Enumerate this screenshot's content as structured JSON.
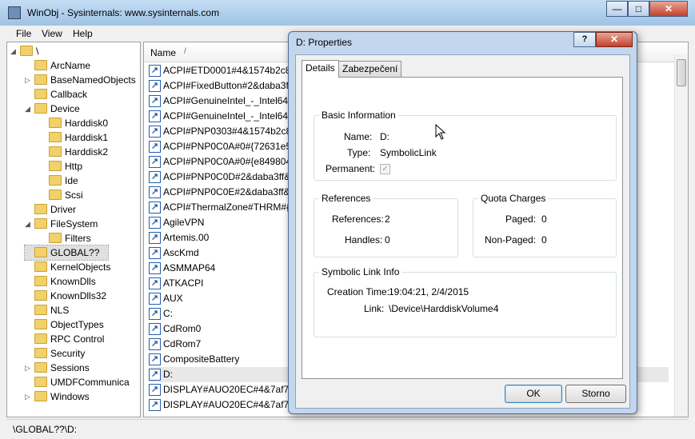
{
  "window": {
    "title": "WinObj - Sysinternals: www.sysinternals.com",
    "min": "—",
    "max": "□",
    "close": "✕"
  },
  "menu": [
    "File",
    "View",
    "Help"
  ],
  "tree": [
    {
      "label": "\\",
      "depth": 0,
      "expander": "◢"
    },
    {
      "label": "ArcName",
      "depth": 1,
      "expander": ""
    },
    {
      "label": "BaseNamedObjects",
      "depth": 1,
      "expander": "▷"
    },
    {
      "label": "Callback",
      "depth": 1,
      "expander": ""
    },
    {
      "label": "Device",
      "depth": 1,
      "expander": "◢"
    },
    {
      "label": "Harddisk0",
      "depth": 2,
      "expander": ""
    },
    {
      "label": "Harddisk1",
      "depth": 2,
      "expander": ""
    },
    {
      "label": "Harddisk2",
      "depth": 2,
      "expander": ""
    },
    {
      "label": "Http",
      "depth": 2,
      "expander": ""
    },
    {
      "label": "Ide",
      "depth": 2,
      "expander": ""
    },
    {
      "label": "Scsi",
      "depth": 2,
      "expander": ""
    },
    {
      "label": "Driver",
      "depth": 1,
      "expander": ""
    },
    {
      "label": "FileSystem",
      "depth": 1,
      "expander": "◢"
    },
    {
      "label": "Filters",
      "depth": 2,
      "expander": ""
    },
    {
      "label": "GLOBAL??",
      "depth": 1,
      "expander": "",
      "selected": true
    },
    {
      "label": "KernelObjects",
      "depth": 1,
      "expander": ""
    },
    {
      "label": "KnownDlls",
      "depth": 1,
      "expander": ""
    },
    {
      "label": "KnownDlls32",
      "depth": 1,
      "expander": ""
    },
    {
      "label": "NLS",
      "depth": 1,
      "expander": ""
    },
    {
      "label": "ObjectTypes",
      "depth": 1,
      "expander": ""
    },
    {
      "label": "RPC Control",
      "depth": 1,
      "expander": ""
    },
    {
      "label": "Security",
      "depth": 1,
      "expander": ""
    },
    {
      "label": "Sessions",
      "depth": 1,
      "expander": "▷"
    },
    {
      "label": "UMDFCommunica",
      "depth": 1,
      "expander": ""
    },
    {
      "label": "Windows",
      "depth": 1,
      "expander": "▷"
    }
  ],
  "list": {
    "column_name": "Name",
    "sort_indicator": "/",
    "items": [
      "ACPI#ETD0001#4&1574b2c8&",
      "ACPI#FixedButton#2&daba3ff",
      "ACPI#GenuineIntel_-_Intel64_",
      "ACPI#GenuineIntel_-_Intel64_",
      "ACPI#PNP0303#4&1574b2c8&",
      "ACPI#PNP0C0A#0#{72631e54",
      "ACPI#PNP0C0A#0#{e849804e",
      "ACPI#PNP0C0D#2&daba3ff&",
      "ACPI#PNP0C0E#2&daba3ff&2",
      "ACPI#ThermalZone#THRM#{4",
      "AgileVPN",
      "Artemis.00",
      "AscKmd",
      "ASMMAP64",
      "ATKACPI",
      "AUX",
      "C:",
      "CdRom0",
      "CdRom7",
      "CompositeBattery",
      "D:",
      "DISPLAY#AUO20EC#4&7af726",
      "DISPLAY#AUO20EC#4&7af726"
    ],
    "selected_index": 20
  },
  "status": "\\GLOBAL??\\D:",
  "dialog": {
    "title": "D: Properties",
    "help": "?",
    "close": "✕",
    "tabs": [
      "Details",
      "Zabezpečení"
    ],
    "basic_info": {
      "title": "Basic Information",
      "name_label": "Name:",
      "name_value": "D:",
      "type_label": "Type:",
      "type_value": "SymbolicLink",
      "permanent_label": "Permanent:",
      "permanent_checked": true,
      "check_glyph": "✓"
    },
    "references": {
      "title": "References",
      "references_label": "References:",
      "references_value": "2",
      "handles_label": "Handles:",
      "handles_value": "0"
    },
    "quota": {
      "title": "Quota Charges",
      "paged_label": "Paged:",
      "paged_value": "0",
      "nonpaged_label": "Non-Paged:",
      "nonpaged_value": "0"
    },
    "symlink": {
      "title": "Symbolic Link Info",
      "creation_label": "Creation Time:",
      "creation_value": "19:04:21, 2/4/2015",
      "link_label": "Link:",
      "link_value": "\\Device\\HarddiskVolume4"
    },
    "ok": "OK",
    "cancel": "Storno"
  },
  "colors": {
    "titlebar": "#9fc3e6",
    "dialog_frame": "#c3d6ec",
    "link_icon": "#2a5da8",
    "folder": "#f2d06a"
  }
}
